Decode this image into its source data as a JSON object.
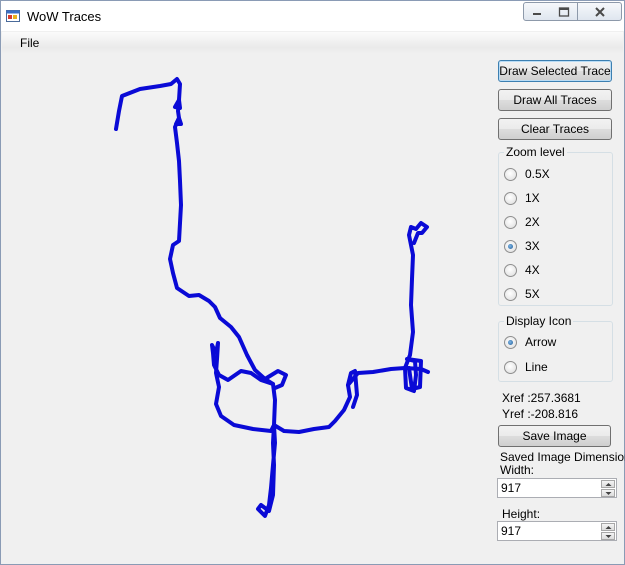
{
  "window": {
    "title": "WoW Traces",
    "icon": "app-window-icon",
    "controls": [
      "minimize-icon",
      "maximize-icon",
      "close-icon"
    ]
  },
  "menu": {
    "items": [
      {
        "label": "File"
      }
    ]
  },
  "buttons": {
    "draw_selected": "Draw Selected Trace",
    "draw_all": "Draw All Traces",
    "clear": "Clear Traces",
    "save_image": "Save Image"
  },
  "zoom": {
    "label": "Zoom level",
    "options": [
      "0.5X",
      "1X",
      "2X",
      "3X",
      "4X",
      "5X"
    ],
    "selected": "3X"
  },
  "display_icon": {
    "label": "Display Icon",
    "options": [
      "Arrow",
      "Line"
    ],
    "selected": "Arrow"
  },
  "coords": {
    "xref": "Xref :257.3681",
    "yref": "Yref :-208.816"
  },
  "saved_image": {
    "heading": "Saved Image Dimensions",
    "width_label": "Width:",
    "width_value": "917",
    "height_label": "Height:",
    "height_value": "917"
  },
  "trace": {
    "color": "#0a0ad6"
  }
}
